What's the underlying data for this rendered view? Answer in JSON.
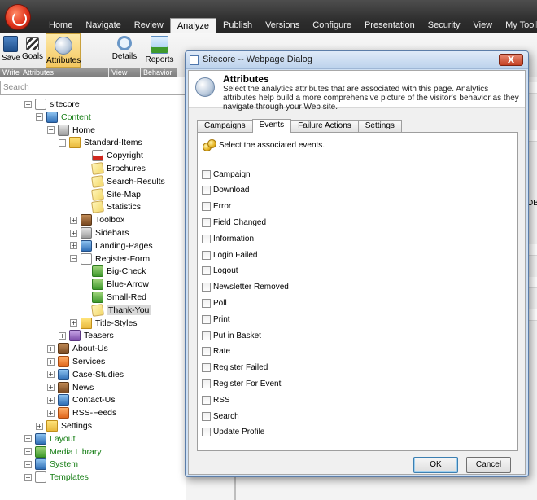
{
  "top_menu": {
    "items": [
      "Home",
      "Navigate",
      "Review",
      "Analyze",
      "Publish",
      "Versions",
      "Configure",
      "Presentation",
      "Security",
      "View",
      "My Toolbar"
    ],
    "active": "Analyze"
  },
  "ribbon": {
    "buttons": [
      {
        "label": "Save",
        "icon": "save-icon"
      },
      {
        "label": "Goals",
        "icon": "goals-flag-icon"
      },
      {
        "label": "Attributes",
        "icon": "attributes-icon",
        "selected": true
      },
      {
        "label": "Details",
        "icon": "details-magnifier-icon"
      },
      {
        "label": "Reports",
        "icon": "reports-chart-icon"
      }
    ],
    "groups": [
      "Write",
      "Attributes",
      "View",
      "Behavior"
    ]
  },
  "search": {
    "placeholder": "Search"
  },
  "tree": [
    {
      "label": "sitecore",
      "expander": "−",
      "icon": "doc"
    },
    {
      "label": "Content",
      "expander": "−",
      "icon": "blue",
      "green": true
    },
    {
      "label": "Home",
      "expander": "−",
      "icon": "gray"
    },
    {
      "label": "Standard-Items",
      "expander": "−",
      "icon": "folder"
    },
    {
      "label": "Copyright",
      "expander": "",
      "icon": "pdf"
    },
    {
      "label": "Brochures",
      "expander": "",
      "icon": "note"
    },
    {
      "label": "Search-Results",
      "expander": "",
      "icon": "note"
    },
    {
      "label": "Site-Map",
      "expander": "",
      "icon": "note"
    },
    {
      "label": "Statistics",
      "expander": "",
      "icon": "note"
    },
    {
      "label": "Toolbox",
      "expander": "+",
      "icon": "brown"
    },
    {
      "label": "Sidebars",
      "expander": "+",
      "icon": "gray"
    },
    {
      "label": "Landing-Pages",
      "expander": "+",
      "icon": "blue"
    },
    {
      "label": "Register-Form",
      "expander": "−",
      "icon": "doc"
    },
    {
      "label": "Big-Check",
      "expander": "",
      "icon": "green"
    },
    {
      "label": "Blue-Arrow",
      "expander": "",
      "icon": "green"
    },
    {
      "label": "Small-Red",
      "expander": "",
      "icon": "green"
    },
    {
      "label": "Thank-You",
      "expander": "",
      "icon": "note",
      "selected": true
    },
    {
      "label": "Title-Styles",
      "expander": "+",
      "icon": "folder"
    },
    {
      "label": "Teasers",
      "expander": "+",
      "icon": "purple"
    },
    {
      "label": "About-Us",
      "expander": "+",
      "icon": "brown"
    },
    {
      "label": "Services",
      "expander": "+",
      "icon": "orange"
    },
    {
      "label": "Case-Studies",
      "expander": "+",
      "icon": "blue"
    },
    {
      "label": "News",
      "expander": "+",
      "icon": "brown"
    },
    {
      "label": "Contact-Us",
      "expander": "+",
      "icon": "blue"
    },
    {
      "label": "RSS-Feeds",
      "expander": "+",
      "icon": "orange"
    },
    {
      "label": "Settings",
      "expander": "+",
      "icon": "folder"
    },
    {
      "label": "Layout",
      "expander": "+",
      "icon": "blue",
      "green": true
    },
    {
      "label": "Media Library",
      "expander": "+",
      "icon": "green",
      "green": true
    },
    {
      "label": "System",
      "expander": "+",
      "icon": "blue",
      "green": true
    },
    {
      "label": "Templates",
      "expander": "+",
      "icon": "doc",
      "green": true
    }
  ],
  "background_text": {
    "partial": "DB"
  },
  "dialog": {
    "title": "Sitecore -- Webpage Dialog",
    "close_label": "X",
    "header_title": "Attributes",
    "header_description": "Select the analytics attributes that are associated with this page. Analytics attributes help build a more comprehensive picture of the visitor's behavior as they navigate through your Web site.",
    "tabs": [
      "Campaigns",
      "Events",
      "Failure Actions",
      "Settings"
    ],
    "active_tab": "Events",
    "events_heading": "Select the associated events.",
    "events": [
      "Campaign",
      "Download",
      "Error",
      "Field Changed",
      "Information",
      "Login Failed",
      "Logout",
      "Newsletter Removed",
      "Poll",
      "Print",
      "Put in Basket",
      "Rate",
      "Register Failed",
      "Register For Event",
      "RSS",
      "Search",
      "Update Profile"
    ],
    "ok_label": "OK",
    "cancel_label": "Cancel"
  }
}
